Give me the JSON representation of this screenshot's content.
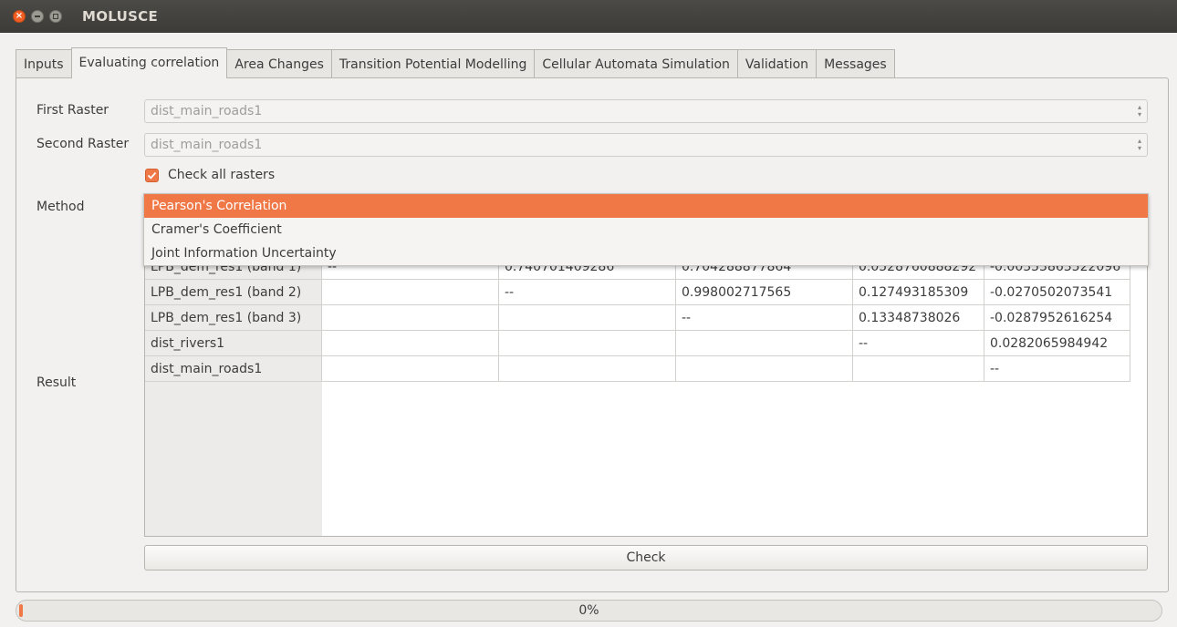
{
  "window": {
    "title": "MOLUSCE"
  },
  "tabs": [
    {
      "label": "Inputs"
    },
    {
      "label": "Evaluating correlation",
      "active": true
    },
    {
      "label": "Area Changes"
    },
    {
      "label": "Transition Potential Modelling"
    },
    {
      "label": "Cellular Automata Simulation"
    },
    {
      "label": "Validation"
    },
    {
      "label": "Messages"
    }
  ],
  "form": {
    "first_raster_label": "First Raster",
    "first_raster_value": "dist_main_roads1",
    "second_raster_label": "Second Raster",
    "second_raster_value": "dist_main_roads1",
    "check_all_label": "Check all rasters",
    "check_all_checked": true,
    "method_label": "Method",
    "method_options": [
      "Pearson's Correlation",
      "Cramer's Coefficient",
      "Joint Information Uncertainty"
    ],
    "method_selected": "Pearson's Correlation",
    "result_label": "Result"
  },
  "result_table": {
    "rows": [
      {
        "header": "LPB_dem_res1 (band 1)",
        "cells": [
          "--",
          "0.740701409286",
          "0.704288877864",
          "0.0528760888292",
          "-0.00353863522096"
        ]
      },
      {
        "header": "LPB_dem_res1 (band 2)",
        "cells": [
          "",
          "--",
          "0.998002717565",
          "0.127493185309",
          "-0.0270502073541"
        ]
      },
      {
        "header": "LPB_dem_res1 (band 3)",
        "cells": [
          "",
          "",
          "--",
          "0.13348738026",
          "-0.0287952616254"
        ]
      },
      {
        "header": "dist_rivers1",
        "cells": [
          "",
          "",
          "",
          "--",
          "0.0282065984942"
        ]
      },
      {
        "header": "dist_main_roads1",
        "cells": [
          "",
          "",
          "",
          "",
          "--"
        ]
      }
    ]
  },
  "check_button_label": "Check",
  "progress": {
    "text": "0%",
    "value": 0
  },
  "colors": {
    "accent": "#f07746",
    "titlebar": "#3c3b37"
  }
}
